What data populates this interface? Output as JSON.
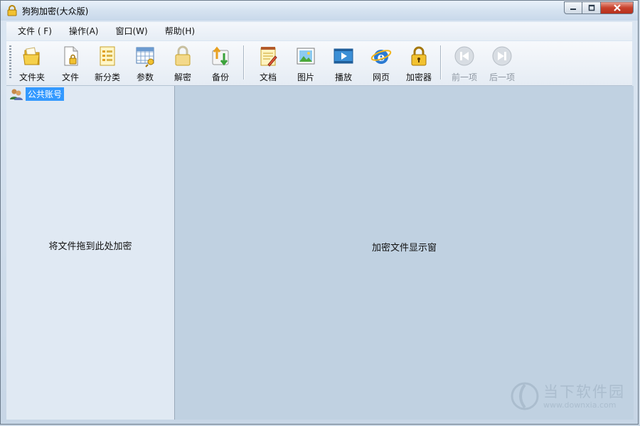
{
  "window": {
    "title": "狗狗加密(大众版)"
  },
  "menubar": {
    "items": [
      "文件 ( F)",
      "操作(A)",
      "窗口(W)",
      "帮助(H)"
    ]
  },
  "toolbar": {
    "buttons": [
      {
        "label": "文件夹",
        "icon": "folder-icon"
      },
      {
        "label": "文件",
        "icon": "file-icon"
      },
      {
        "label": "新分类",
        "icon": "new-category-icon"
      },
      {
        "label": "参数",
        "icon": "settings-grid-icon"
      },
      {
        "label": "解密",
        "icon": "unlock-icon"
      },
      {
        "label": "备份",
        "icon": "backup-icon"
      },
      {
        "label": "文档",
        "icon": "document-icon"
      },
      {
        "label": "图片",
        "icon": "picture-icon"
      },
      {
        "label": "播放",
        "icon": "play-icon"
      },
      {
        "label": "网页",
        "icon": "ie-icon"
      },
      {
        "label": "加密器",
        "icon": "lock-icon"
      },
      {
        "label": "前一项",
        "icon": "prev-icon",
        "disabled": true
      },
      {
        "label": "后一项",
        "icon": "next-icon",
        "disabled": true
      }
    ]
  },
  "left_pane": {
    "tree_root": "公共账号",
    "hint": "将文件拖到此处加密"
  },
  "right_pane": {
    "hint": "加密文件显示窗"
  },
  "watermark": {
    "brand": "当下软件园",
    "url": "www.downxia.com"
  }
}
